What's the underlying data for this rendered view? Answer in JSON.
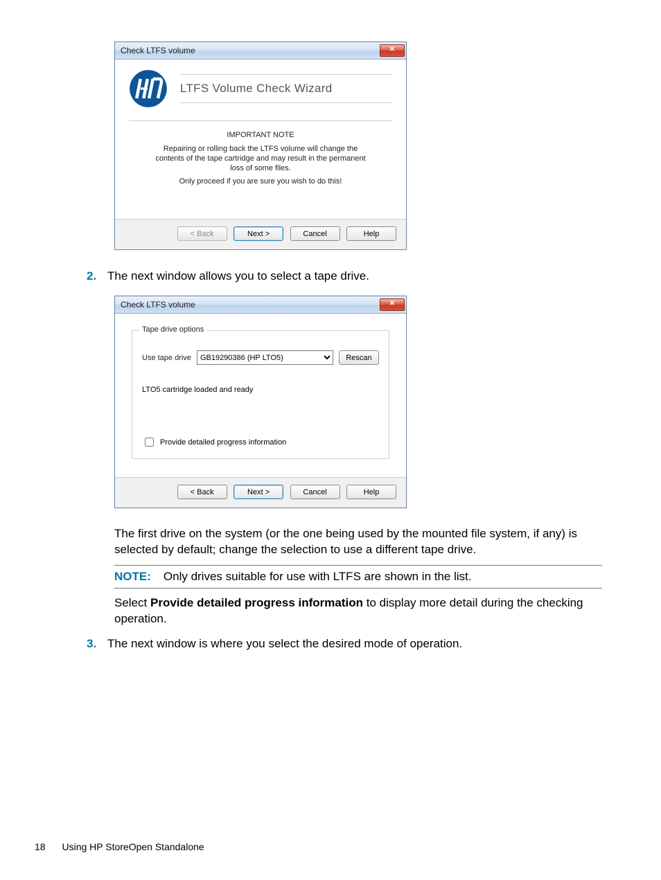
{
  "dialog1": {
    "title": "Check LTFS volume",
    "wizard_title": "LTFS Volume Check Wizard",
    "note_head": "IMPORTANT NOTE",
    "note_p1": "Repairing or rolling back the LTFS volume will change the contents of the tape cartridge and may result in the permanent loss of some files.",
    "note_p2": "Only proceed if you are sure you wish to do this!",
    "btn_back": "< Back",
    "btn_next": "Next >",
    "btn_cancel": "Cancel",
    "btn_help": "Help"
  },
  "step2": {
    "num": "2.",
    "text": "The next window allows you to select a tape drive."
  },
  "dialog2": {
    "title": "Check LTFS volume",
    "group_legend": "Tape drive options",
    "lbl_use": "Use tape drive",
    "drive_value": "GB19290386 (HP LTO5)",
    "btn_rescan": "Rescan",
    "status": "LTO5 cartridge loaded and ready",
    "chk_label": "Provide detailed progress information",
    "btn_back": "< Back",
    "btn_next": "Next >",
    "btn_cancel": "Cancel",
    "btn_help": "Help"
  },
  "para1": "The first drive on the system (or the one being used by the mounted file system, if any) is selected by default; change the selection to use a different tape drive.",
  "note": {
    "label": "NOTE:",
    "text": "Only drives suitable for use with LTFS are shown in the list."
  },
  "para2_a": "Select ",
  "para2_b": "Provide detailed progress information",
  "para2_c": " to display more detail during the checking operation.",
  "step3": {
    "num": "3.",
    "text": "The next window is where you select the desired mode of operation."
  },
  "footer": {
    "page": "18",
    "section": "Using HP StoreOpen Standalone"
  }
}
